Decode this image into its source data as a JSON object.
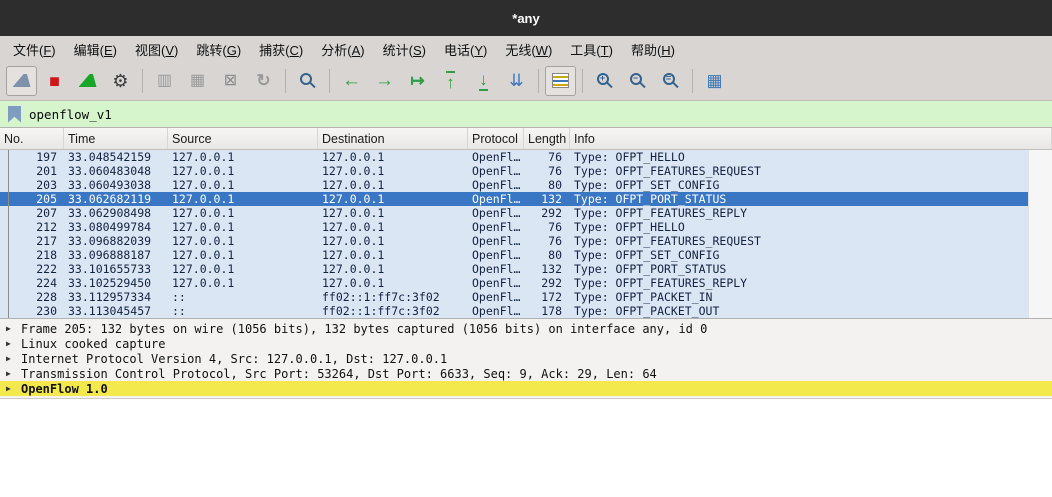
{
  "window": {
    "title": "*any"
  },
  "menu_bar": {
    "items": [
      {
        "id": "file",
        "label": "文件",
        "mnemonic": "F"
      },
      {
        "id": "edit",
        "label": "编辑",
        "mnemonic": "E"
      },
      {
        "id": "view",
        "label": "视图",
        "mnemonic": "V"
      },
      {
        "id": "go",
        "label": "跳转",
        "mnemonic": "G"
      },
      {
        "id": "capture",
        "label": "捕获",
        "mnemonic": "C"
      },
      {
        "id": "analyze",
        "label": "分析",
        "mnemonic": "A"
      },
      {
        "id": "statistics",
        "label": "统计",
        "mnemonic": "S"
      },
      {
        "id": "telephony",
        "label": "电话",
        "mnemonic": "Y"
      },
      {
        "id": "wireless",
        "label": "无线",
        "mnemonic": "W"
      },
      {
        "id": "tools",
        "label": "工具",
        "mnemonic": "T"
      },
      {
        "id": "help",
        "label": "帮助",
        "mnemonic": "H"
      }
    ]
  },
  "toolbar": {
    "buttons": [
      {
        "name": "start-capture",
        "type": "fin",
        "color": "#7d93ab",
        "framed": true
      },
      {
        "name": "stop-capture",
        "type": "glyph",
        "glyph": "■",
        "color": "#d01717",
        "size": 18
      },
      {
        "name": "restart-capture",
        "type": "fin",
        "color": "#18a528"
      },
      {
        "name": "capture-options",
        "type": "glyph",
        "glyph": "⚙",
        "color": "#3a3a3a",
        "size": 18
      },
      {
        "separator": true
      },
      {
        "name": "open-file",
        "type": "glyph",
        "glyph": "▥",
        "color": "#9a9a9a",
        "size": 16
      },
      {
        "name": "save-file",
        "type": "glyph",
        "glyph": "▦",
        "color": "#9a9a9a",
        "size": 16
      },
      {
        "name": "close-file",
        "type": "glyph",
        "glyph": "⊠",
        "color": "#8a8a8a",
        "size": 16
      },
      {
        "name": "reload-file",
        "type": "glyph",
        "glyph": "↻",
        "color": "#9a9a9a",
        "size": 17,
        "bold": true
      },
      {
        "separator": true
      },
      {
        "name": "find-packet",
        "type": "mag",
        "label": ""
      },
      {
        "separator": true
      },
      {
        "name": "previous-packet",
        "type": "glyph",
        "glyph": "←",
        "color": "#2f9e44",
        "size": 19,
        "bold": true
      },
      {
        "name": "next-packet",
        "type": "glyph",
        "glyph": "→",
        "color": "#2f9e44",
        "size": 19,
        "bold": true
      },
      {
        "name": "go-to-packet",
        "type": "glyph",
        "glyph": "↦",
        "color": "#2f9e44",
        "size": 17,
        "bold": true
      },
      {
        "name": "first-packet",
        "type": "glyph",
        "glyph": "↑",
        "color": "#2f9e44",
        "size": 17,
        "bold": true,
        "bar": "top"
      },
      {
        "name": "last-packet",
        "type": "glyph",
        "glyph": "↓",
        "color": "#2f9e44",
        "size": 17,
        "bold": true,
        "bar": "bottom"
      },
      {
        "name": "auto-scroll",
        "type": "glyph",
        "glyph": "⇊",
        "color": "#3d77b8",
        "size": 17
      },
      {
        "separator": true
      },
      {
        "name": "colorize",
        "type": "stripes",
        "framed": true
      },
      {
        "separator": true
      },
      {
        "name": "zoom-in",
        "type": "mag",
        "label": "+"
      },
      {
        "name": "zoom-out",
        "type": "mag",
        "label": "−"
      },
      {
        "name": "zoom-original",
        "type": "mag",
        "label": "="
      },
      {
        "separator": true
      },
      {
        "name": "resize-columns",
        "type": "glyph",
        "glyph": "▦",
        "color": "#3d77b8",
        "size": 17
      }
    ]
  },
  "filter_bar": {
    "value": "openflow_v1"
  },
  "packet_list": {
    "columns": [
      {
        "id": "no",
        "label": "No."
      },
      {
        "id": "time",
        "label": "Time"
      },
      {
        "id": "source",
        "label": "Source"
      },
      {
        "id": "destination",
        "label": "Destination"
      },
      {
        "id": "protocol",
        "label": "Protocol"
      },
      {
        "id": "length",
        "label": "Length"
      },
      {
        "id": "info",
        "label": "Info"
      }
    ],
    "rows": [
      {
        "no": "197",
        "time": "33.048542159",
        "source": "127.0.0.1",
        "destination": "127.0.0.1",
        "protocol": "OpenFl…",
        "length": "76",
        "info": "Type: OFPT_HELLO",
        "selected": false
      },
      {
        "no": "201",
        "time": "33.060483048",
        "source": "127.0.0.1",
        "destination": "127.0.0.1",
        "protocol": "OpenFl…",
        "length": "76",
        "info": "Type: OFPT_FEATURES_REQUEST",
        "selected": false
      },
      {
        "no": "203",
        "time": "33.060493038",
        "source": "127.0.0.1",
        "destination": "127.0.0.1",
        "protocol": "OpenFl…",
        "length": "80",
        "info": "Type: OFPT_SET_CONFIG",
        "selected": false
      },
      {
        "no": "205",
        "time": "33.062682119",
        "source": "127.0.0.1",
        "destination": "127.0.0.1",
        "protocol": "OpenFl…",
        "length": "132",
        "info": "Type: OFPT_PORT_STATUS",
        "selected": true
      },
      {
        "no": "207",
        "time": "33.062908498",
        "source": "127.0.0.1",
        "destination": "127.0.0.1",
        "protocol": "OpenFl…",
        "length": "292",
        "info": "Type: OFPT_FEATURES_REPLY",
        "selected": false
      },
      {
        "no": "212",
        "time": "33.080499784",
        "source": "127.0.0.1",
        "destination": "127.0.0.1",
        "protocol": "OpenFl…",
        "length": "76",
        "info": "Type: OFPT_HELLO",
        "selected": false
      },
      {
        "no": "217",
        "time": "33.096882039",
        "source": "127.0.0.1",
        "destination": "127.0.0.1",
        "protocol": "OpenFl…",
        "length": "76",
        "info": "Type: OFPT_FEATURES_REQUEST",
        "selected": false
      },
      {
        "no": "218",
        "time": "33.096888187",
        "source": "127.0.0.1",
        "destination": "127.0.0.1",
        "protocol": "OpenFl…",
        "length": "80",
        "info": "Type: OFPT_SET_CONFIG",
        "selected": false
      },
      {
        "no": "222",
        "time": "33.101655733",
        "source": "127.0.0.1",
        "destination": "127.0.0.1",
        "protocol": "OpenFl…",
        "length": "132",
        "info": "Type: OFPT_PORT_STATUS",
        "selected": false
      },
      {
        "no": "224",
        "time": "33.102529450",
        "source": "127.0.0.1",
        "destination": "127.0.0.1",
        "protocol": "OpenFl…",
        "length": "292",
        "info": "Type: OFPT_FEATURES_REPLY",
        "selected": false
      },
      {
        "no": "228",
        "time": "33.112957334",
        "source": "::",
        "destination": "ff02::1:ff7c:3f02",
        "protocol": "OpenFl…",
        "length": "172",
        "info": "Type: OFPT_PACKET_IN",
        "selected": false
      },
      {
        "no": "230",
        "time": "33.113045457",
        "source": "::",
        "destination": "ff02::1:ff7c:3f02",
        "protocol": "OpenFl…",
        "length": "178",
        "info": "Type: OFPT_PACKET_OUT",
        "selected": false
      }
    ]
  },
  "packet_details": {
    "rows": [
      {
        "text": "Frame 205: 132 bytes on wire (1056 bits), 132 bytes captured (1056 bits) on interface any, id 0",
        "selected": false
      },
      {
        "text": "Linux cooked capture",
        "selected": false
      },
      {
        "text": "Internet Protocol Version 4, Src: 127.0.0.1, Dst: 127.0.0.1",
        "selected": false
      },
      {
        "text": "Transmission Control Protocol, Src Port: 53264, Dst Port: 6633, Seq: 9, Ack: 29, Len: 64",
        "selected": false
      },
      {
        "text": "OpenFlow 1.0",
        "selected": true
      }
    ],
    "expander_glyph": "▶"
  },
  "colors": {
    "titlebar_bg": "#2d2d2d",
    "chrome_bg": "#d8d5d2",
    "filter_bg": "#d6f5cd",
    "row_bg": "#dbe6f5",
    "row_text": "#13233f",
    "selected_row_bg": "#3976c4",
    "selected_row_text": "#ffffff",
    "details_bg": "#f3f2f1",
    "highlight_bg": "#f3e94d"
  }
}
